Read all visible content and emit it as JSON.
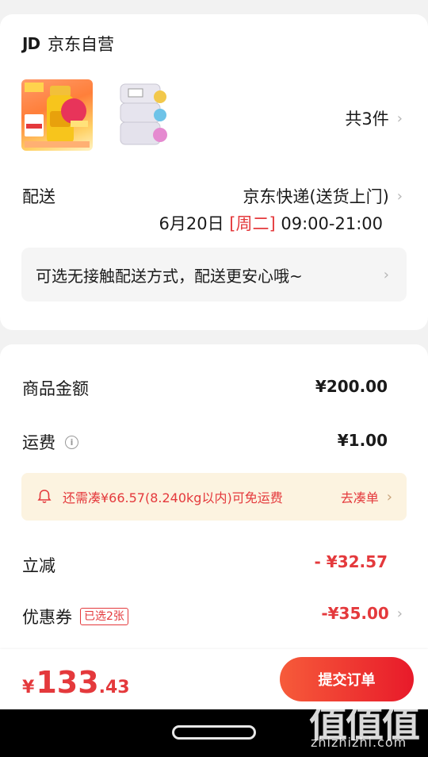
{
  "order": {
    "store_logo": "JD",
    "store_name": "京东自营",
    "thumbs": [
      "product-oil-image",
      "product-milk-container-image"
    ],
    "item_count": "共3件",
    "shipping_label": "配送",
    "shipping_method": "京东快递(送货上门)",
    "shipping_date": "6月20日",
    "shipping_weekday": "[周二]",
    "shipping_time": "09:00-21:00",
    "contactless_notice": "可选无接触配送方式，配送更安心哦~"
  },
  "summary": {
    "goods_label": "商品金额",
    "goods_value": "¥200.00",
    "freight_label": "运费",
    "freight_value": "¥1.00",
    "free_ship_text": "还需凑¥66.57(8.240kg以内)可免运费",
    "free_ship_link": "去凑单",
    "discount_label": "立减",
    "discount_value": "- ¥32.57",
    "coupon_label": "优惠券",
    "coupon_tag": "已选2张",
    "coupon_value": "-¥35.00"
  },
  "footer": {
    "currency": "¥",
    "total_int": "133",
    "total_dec": ".43",
    "submit_label": "提交订单"
  },
  "watermark": {
    "mark": "值值值",
    "url": "zhizhizhi.com"
  },
  "colors": {
    "accent": "#e4393c",
    "button_start": "#f65b3a",
    "button_end": "#e81a2a",
    "notice_bg": "#fcf3e0"
  }
}
